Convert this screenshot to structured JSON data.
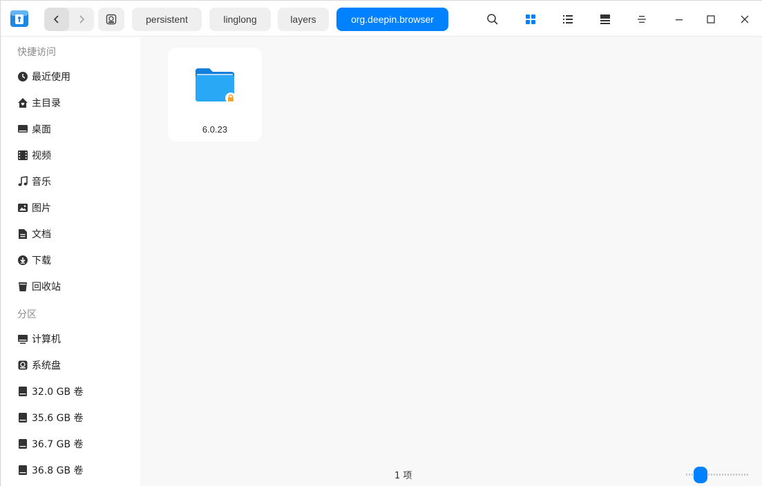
{
  "breadcrumbs": [
    {
      "label": "persistent",
      "active": false
    },
    {
      "label": "linglong",
      "active": false
    },
    {
      "label": "layers",
      "active": false
    },
    {
      "label": "org.deepin.browser",
      "active": true
    }
  ],
  "icons": {
    "app": "file-manager-logo-icon",
    "back": "chevron-left-icon",
    "forward": "chevron-right-icon",
    "disk": "disk-icon",
    "search": "search-icon",
    "icon_view": "grid-view-icon",
    "list_view": "list-view-icon",
    "detail_view": "detail-view-icon",
    "menu": "hamburger-menu-icon",
    "minimize": "minimize-icon",
    "maximize": "maximize-icon",
    "close": "close-icon"
  },
  "sidebar": {
    "quick_access_title": "快捷访问",
    "quick_access": [
      {
        "label": "最近使用",
        "icon": "clock-icon"
      },
      {
        "label": "主目录",
        "icon": "home-icon"
      },
      {
        "label": "桌面",
        "icon": "desktop-icon"
      },
      {
        "label": "视频",
        "icon": "video-icon"
      },
      {
        "label": "音乐",
        "icon": "music-icon"
      },
      {
        "label": "图片",
        "icon": "picture-icon"
      },
      {
        "label": "文档",
        "icon": "document-icon"
      },
      {
        "label": "下载",
        "icon": "download-icon"
      },
      {
        "label": "回收站",
        "icon": "trash-icon"
      }
    ],
    "partitions_title": "分区",
    "partitions": [
      {
        "label": "计算机",
        "icon": "computer-icon"
      },
      {
        "label": "系统盘",
        "icon": "system-disk-icon"
      },
      {
        "label": "32.0  GB 卷",
        "icon": "drive-icon"
      },
      {
        "label": "35.6  GB 卷",
        "icon": "drive-icon"
      },
      {
        "label": "36.7  GB 卷",
        "icon": "drive-icon"
      },
      {
        "label": "36.8  GB 卷",
        "icon": "drive-icon"
      }
    ]
  },
  "files": [
    {
      "name": "6.0.23",
      "icon": "locked-folder-icon"
    }
  ],
  "status": {
    "item_count": "1 项"
  },
  "zoom": {
    "level_fraction": 0.15
  },
  "colors": {
    "accent": "#0081ff",
    "folder": "#1e9bf0",
    "lock": "#f5a623"
  }
}
